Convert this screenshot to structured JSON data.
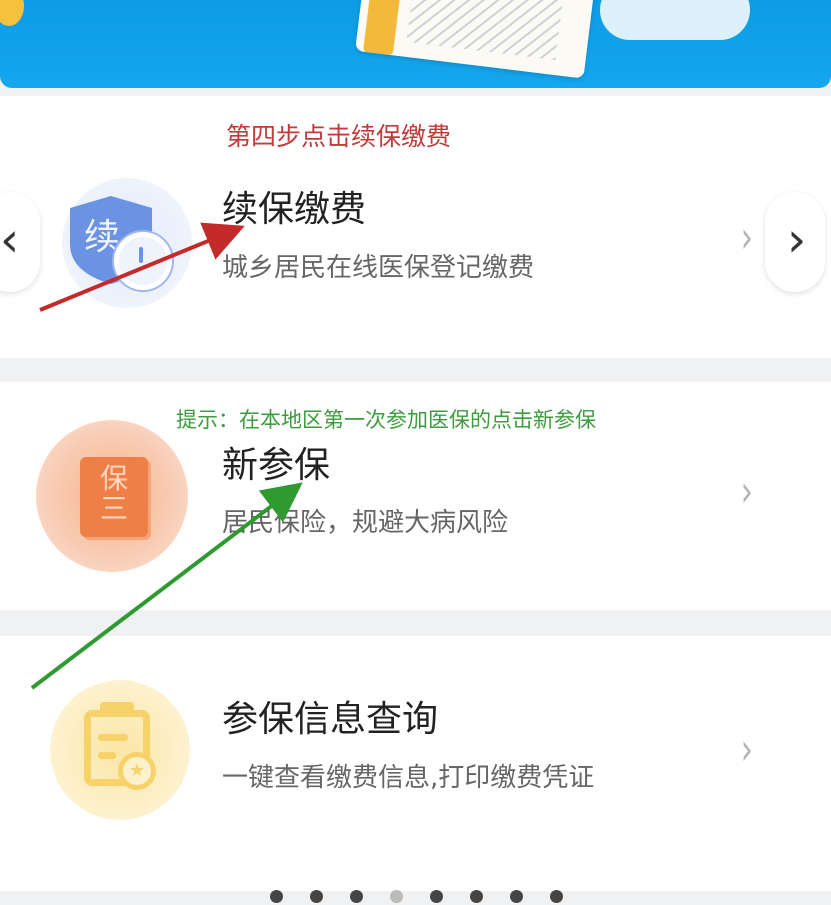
{
  "hints": {
    "step4": "第四步点击续保缴费",
    "new_tip": "提示：在本地区第一次参加医保的点击新参保"
  },
  "items": [
    {
      "title": "续保缴费",
      "subtitle": "城乡居民在线医保登记缴费",
      "icon": "renew-shield-icon",
      "icon_text": "续"
    },
    {
      "title": "新参保",
      "subtitle": "居民保险，规避大病风险",
      "icon": "insurance-book-icon",
      "icon_text": "保三"
    },
    {
      "title": "参保信息查询",
      "subtitle": "一键查看缴费信息,打印缴费凭证",
      "icon": "clipboard-query-icon"
    }
  ],
  "nav": {
    "prev": "‹",
    "next": "›",
    "chevron": "›"
  },
  "pagination": {
    "count": 8,
    "active_index": 3
  },
  "colors": {
    "banner": "#15a6ee",
    "hint_red": "#c23a3a",
    "hint_green": "#3f9b3f",
    "arrow_red": "#c42a2a",
    "arrow_green": "#2f9a2f"
  }
}
